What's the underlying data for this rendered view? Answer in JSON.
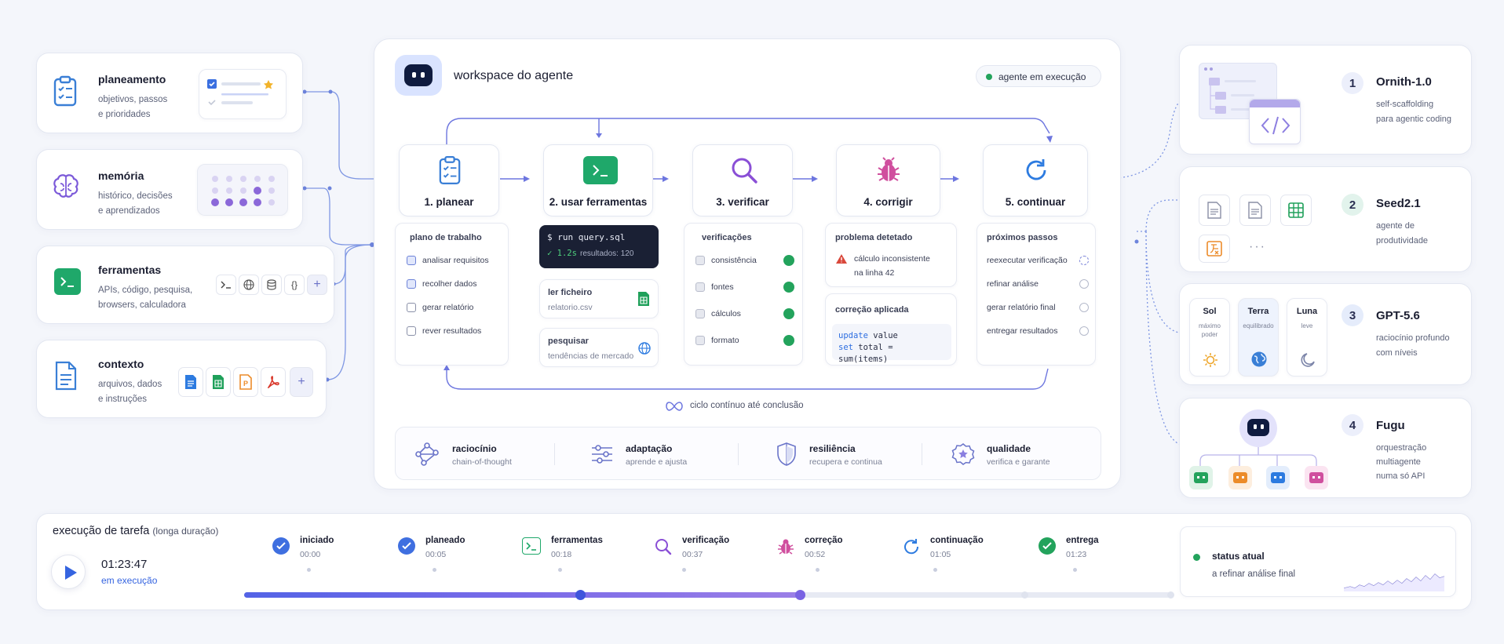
{
  "left_cards": [
    {
      "title": "planeamento",
      "desc1": "objetivos, passos",
      "desc2": "e prioridades"
    },
    {
      "title": "memória",
      "desc1": "histórico, decisões",
      "desc2": "e aprendizados"
    },
    {
      "title": "ferramentas",
      "desc1": "APIs, código, pesquisa,",
      "desc2": "browsers, calculadora"
    },
    {
      "title": "contexto",
      "desc1": "arquivos, dados",
      "desc2": "e instruções"
    }
  ],
  "workspace": {
    "title": "workspace do agente",
    "status": "agente em execução",
    "steps": [
      "1. planear",
      "2. usar ferramentas",
      "3. verificar",
      "4. corrigir",
      "5. continuar"
    ],
    "plan": {
      "title": "plano de trabalho",
      "items": [
        {
          "label": "analisar requisitos",
          "checked": true
        },
        {
          "label": "recolher dados",
          "checked": true
        },
        {
          "label": "gerar relatório",
          "checked": false
        },
        {
          "label": "rever resultados",
          "checked": false
        }
      ]
    },
    "tools": {
      "terminal_cmd": "$ run query.sql",
      "terminal_time": "✓ 1.2s",
      "terminal_result": "resultados: 120",
      "file_title": "ler ficheiro",
      "file_name": "relatorio.csv",
      "search_title": "pesquisar",
      "search_query": "tendências de mercado"
    },
    "verify": {
      "title": "verificações",
      "items": [
        "consistência",
        "fontes",
        "cálculos",
        "formato"
      ]
    },
    "fix": {
      "problem_title": "problema detetado",
      "problem_line1": "cálculo inconsistente",
      "problem_line2": "na linha 42",
      "fix_title": "correção aplicada",
      "code_kw1": "update",
      "code_rest1": " value",
      "code_kw2": "set",
      "code_rest2": " total = sum(items)"
    },
    "next": {
      "title": "próximos passos",
      "items": [
        "reexecutar verificação",
        "refinar análise",
        "gerar relatório final",
        "entregar resultados"
      ]
    },
    "loop_label": "ciclo contínuo até conclusão",
    "features": [
      {
        "title": "raciocínio",
        "desc": "chain-of-thought"
      },
      {
        "title": "adaptação",
        "desc": "aprende e ajusta"
      },
      {
        "title": "resiliência",
        "desc": "recupera e continua"
      },
      {
        "title": "qualidade",
        "desc": "verifica e garante"
      }
    ]
  },
  "models": [
    {
      "rank": "1",
      "name": "Ornith-1.0",
      "desc1": "self-scaffolding",
      "desc2": "para agentic coding"
    },
    {
      "rank": "2",
      "name": "Seed2.1",
      "desc1": "agente de",
      "desc2": "produtividade"
    },
    {
      "rank": "3",
      "name": "GPT-5.6",
      "desc1": "raciocínio profundo",
      "desc2": "com níveis"
    },
    {
      "rank": "4",
      "name": "Fugu",
      "desc1": "orquestração",
      "desc2": "multiagente",
      "desc3": "numa só API"
    }
  ],
  "gpt_levels": [
    {
      "name": "Sol",
      "desc1": "máximo",
      "desc2": "poder"
    },
    {
      "name": "Terra",
      "desc1": "equilibrado",
      "desc2": ""
    },
    {
      "name": "Luna",
      "desc1": "leve",
      "desc2": ""
    }
  ],
  "timeline": {
    "title": "execução de tarefa",
    "subtitle": "(longa duração)",
    "elapsed": "01:23:47",
    "state": "em execução",
    "progress": 0.6,
    "milestones": [
      {
        "label": "iniciado",
        "time": "00:00"
      },
      {
        "label": "planeado",
        "time": "00:05"
      },
      {
        "label": "ferramentas",
        "time": "00:18"
      },
      {
        "label": "verificação",
        "time": "00:37"
      },
      {
        "label": "correção",
        "time": "00:52"
      },
      {
        "label": "continuação",
        "time": "01:05"
      },
      {
        "label": "entrega",
        "time": "01:23"
      }
    ],
    "status_title": "status atual",
    "status_desc": "a refinar análise final"
  },
  "colors": {
    "accent": "#5b6ee8",
    "green": "#23a35c",
    "purple": "#7c5ad9",
    "blue": "#3a7fd6",
    "red": "#d9483b"
  }
}
